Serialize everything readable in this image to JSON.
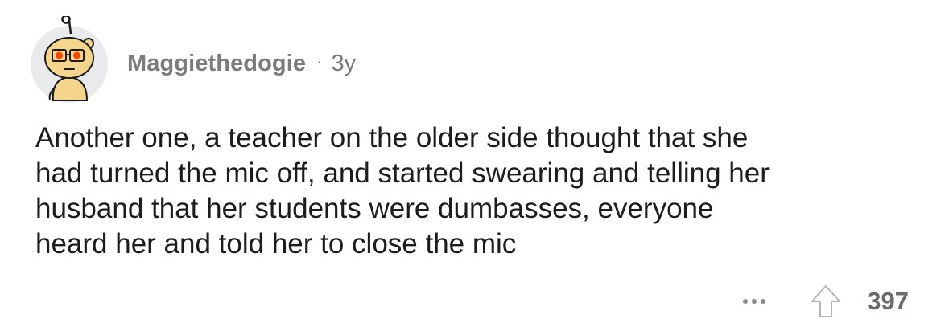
{
  "comment": {
    "username": "Maggiethedogie",
    "separator": "·",
    "age": "3y",
    "body_lines": [
      "Another one, a teacher on the older side thought that she",
      "had turned the mic off, and started swearing and telling her",
      "husband that her students were dumbasses, everyone",
      "heard her and told her to close the mic"
    ],
    "more_icon": "ellipsis-icon",
    "upvote_icon": "upvote-arrow-icon",
    "score": "397"
  },
  "colors": {
    "meta_text": "#7c7c7c",
    "body_text": "#1c1c1c",
    "avatar_bg": "#e9eaeb",
    "avatar_skin": "#f5d48b",
    "avatar_eyes": "#ff4500"
  }
}
